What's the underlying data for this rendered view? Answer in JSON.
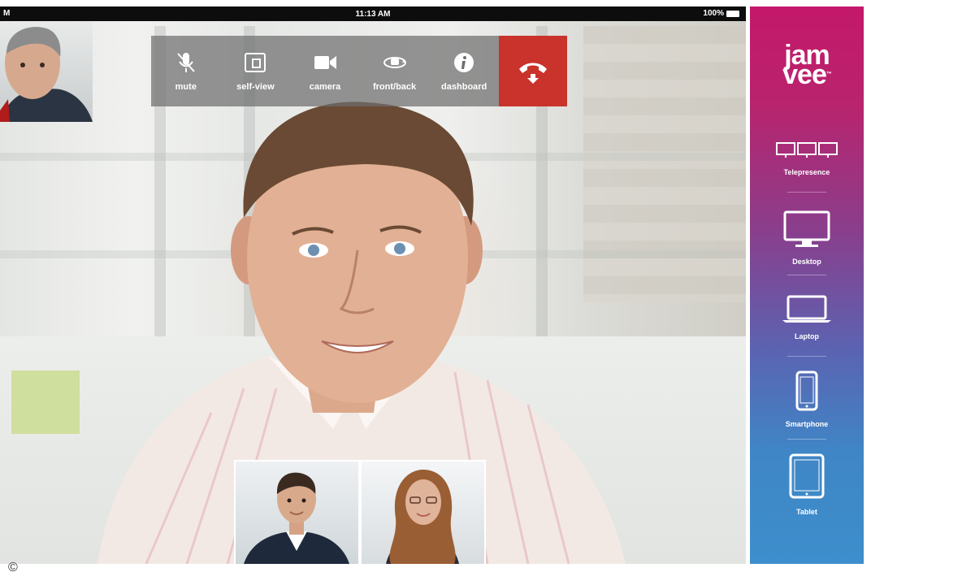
{
  "status_bar": {
    "left": "M",
    "time": "11:13 AM",
    "battery": "100%"
  },
  "toolbar": {
    "buttons": [
      {
        "label": "mute",
        "icon": "mute-mic-icon"
      },
      {
        "label": "self-view",
        "icon": "self-view-icon"
      },
      {
        "label": "camera",
        "icon": "video-camera-icon"
      },
      {
        "label": "front/back",
        "icon": "camera-rotate-icon"
      },
      {
        "label": "dashboard",
        "icon": "info-icon"
      }
    ],
    "end_call_icon": "hang-up-phone-icon"
  },
  "sidebar": {
    "logo_top": "jam",
    "logo_bottom": "vee",
    "logo_mark": "™",
    "devices": [
      {
        "label": "Telepresence",
        "icon": "telepresence-icon"
      },
      {
        "label": "Desktop",
        "icon": "desktop-icon"
      },
      {
        "label": "Laptop",
        "icon": "laptop-icon"
      },
      {
        "label": "Smartphone",
        "icon": "smartphone-icon"
      },
      {
        "label": "Tablet",
        "icon": "tablet-icon"
      }
    ]
  },
  "copyright": "©",
  "colors": {
    "end_call": "#c9332b",
    "sidebar_top": "#c4186a",
    "sidebar_bottom": "#3d8ecc",
    "toolbar_bg": "#6e6e6e"
  }
}
